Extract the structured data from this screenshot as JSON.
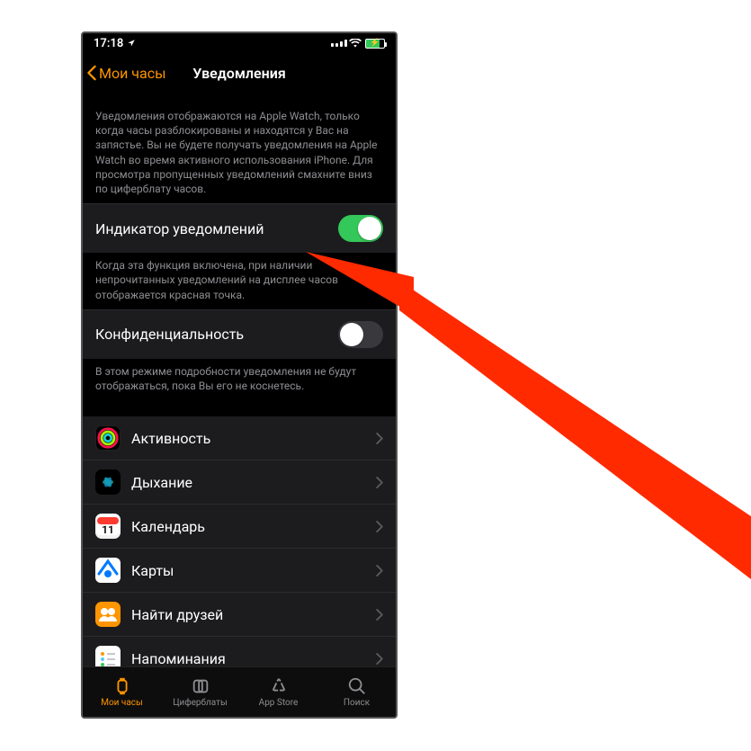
{
  "status": {
    "time": "17:18",
    "location_on": true,
    "wifi": true,
    "battery_pct": 75
  },
  "nav": {
    "back_label": "Мои часы",
    "title": "Уведомления"
  },
  "intro_text": "Уведомления отображаются на Apple Watch, только когда часы разблокированы и находятся у Вас на запястье. Вы не будете получать уведомления на Apple Watch во время активного использования iPhone. Для просмотра пропущенных уведомлений смахните вниз по циферблату часов.",
  "toggle1": {
    "label": "Индикатор уведомлений",
    "on": true,
    "footer": "Когда эта функция включена, при наличии непрочитанных уведомлений на дисплее часов отображается красная точка."
  },
  "toggle2": {
    "label": "Конфиденциальность",
    "on": false,
    "footer": "В этом режиме подробности уведомления не будут отображаться, пока Вы его не коснетесь."
  },
  "apps": [
    {
      "name": "Активность",
      "icon": "activity"
    },
    {
      "name": "Дыхание",
      "icon": "breathe"
    },
    {
      "name": "Календарь",
      "icon": "calendar"
    },
    {
      "name": "Карты",
      "icon": "maps"
    },
    {
      "name": "Найти друзей",
      "icon": "friends"
    },
    {
      "name": "Напоминания",
      "icon": "reminders"
    }
  ],
  "tabs": [
    {
      "label": "Мои часы",
      "icon": "watch",
      "active": true
    },
    {
      "label": "Циферблаты",
      "icon": "faces",
      "active": false
    },
    {
      "label": "App Store",
      "icon": "appstore",
      "active": false
    },
    {
      "label": "Поиск",
      "icon": "search",
      "active": false
    }
  ],
  "arrow": {
    "color": "#ff2a00"
  }
}
